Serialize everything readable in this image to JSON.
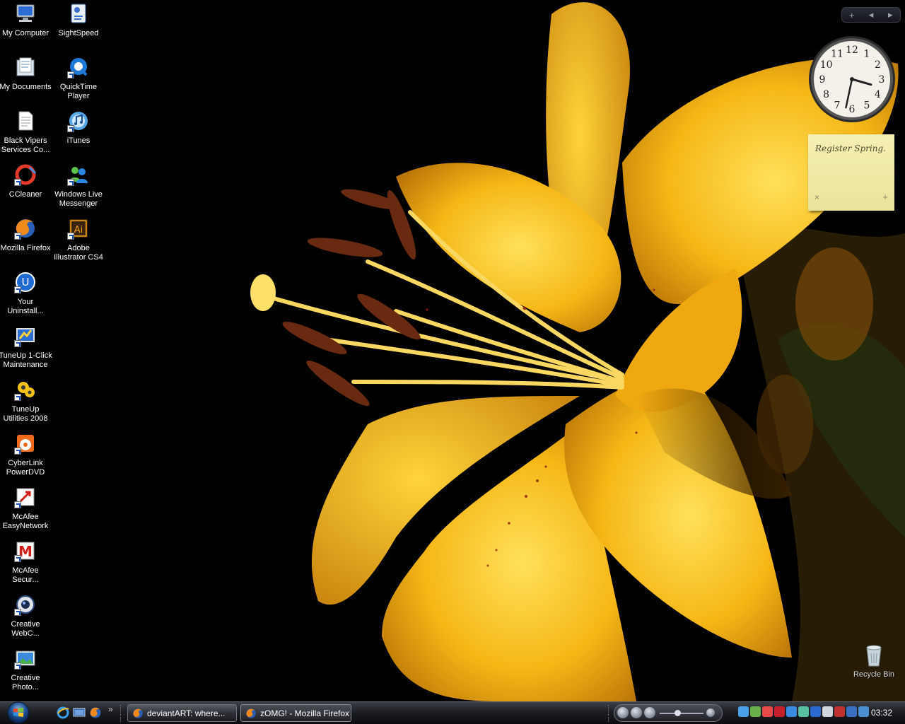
{
  "desktop": {
    "icons": [
      {
        "label": "My Computer",
        "icon": "computer-icon"
      },
      {
        "label": "SightSpeed",
        "icon": "sightspeed-icon"
      },
      {
        "label": "My Documents",
        "icon": "documents-folder-icon"
      },
      {
        "label": "QuickTime\nPlayer",
        "icon": "quicktime-icon"
      },
      {
        "label": "Black Vipers\nServices Co...",
        "icon": "text-document-icon"
      },
      {
        "label": "iTunes",
        "icon": "itunes-icon"
      },
      {
        "label": "CCleaner",
        "icon": "ccleaner-icon"
      },
      {
        "label": "Windows Live\nMessenger",
        "icon": "messenger-icon"
      },
      {
        "label": "Mozilla Firefox",
        "icon": "firefox-icon"
      },
      {
        "label": "Adobe\nIllustrator CS4",
        "icon": "illustrator-icon"
      },
      {
        "label": "Your\nUninstall...",
        "icon": "uninstaller-icon"
      },
      {
        "label": "TuneUp 1-Click\nMaintenance",
        "icon": "tuneup-maintenance-icon"
      },
      {
        "label": "TuneUp\nUtilities 2008",
        "icon": "tuneup-utilities-icon"
      },
      {
        "label": "CyberLink\nPowerDVD",
        "icon": "powerdvd-icon"
      },
      {
        "label": "McAfee\nEasyNetwork",
        "icon": "mcafee-easynetwork-icon"
      },
      {
        "label": "McAfee\nSecur...",
        "icon": "mcafee-security-icon"
      },
      {
        "label": "Creative\nWebC...",
        "icon": "webcam-icon"
      },
      {
        "label": "Creative\nPhoto...",
        "icon": "photo-icon"
      }
    ],
    "recycle_bin": "Recycle Bin"
  },
  "sidebar": {
    "add_symbol": "+",
    "prev_symbol": "◂",
    "next_symbol": "▸"
  },
  "clock_gadget": {
    "numbers": [
      "12",
      "1",
      "2",
      "3",
      "4",
      "5",
      "6",
      "7",
      "8",
      "9",
      "10",
      "11"
    ],
    "time": "03:32"
  },
  "note_gadget": {
    "text": "Register Spring.",
    "close_symbol": "×",
    "add_symbol": "+"
  },
  "taskbar": {
    "quick_launch": [
      "ie-icon",
      "show-desktop-icon",
      "firefox-icon"
    ],
    "more_symbol": "»",
    "tasks": [
      {
        "label": "deviantART: where...",
        "icon": "firefox-icon",
        "active": false
      },
      {
        "label": "zOMG! - Mozilla Firefox",
        "icon": "firefox-icon",
        "active": true
      }
    ],
    "media_player": {
      "volume": 0.4
    },
    "tray_icons": [
      "itunes-tray-icon",
      "network-tray-icon",
      "messenger-tray-icon",
      "mcafee-tray-icon",
      "globe-tray-icon",
      "connection-tray-icon",
      "tuneup-tray-icon",
      "volume-tray-icon",
      "security-tray-icon",
      "display-tray-icon",
      "app-tray-icon"
    ],
    "clock": "03:32"
  },
  "colors": {
    "petal": "#f3b412",
    "petal_highlight": "#ffd84a",
    "anther": "#6a2a12",
    "background": "#000000"
  }
}
